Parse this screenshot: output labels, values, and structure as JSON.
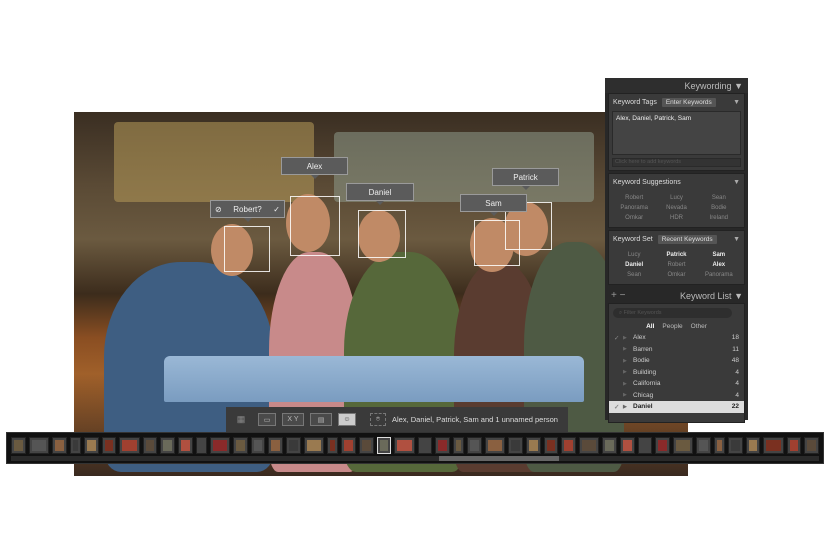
{
  "faces": [
    {
      "label": "Robert?",
      "unconfirmed": true
    },
    {
      "label": "Alex"
    },
    {
      "label": "Daniel"
    },
    {
      "label": "Sam"
    },
    {
      "label": "Patrick"
    }
  ],
  "panel": {
    "title": "Keywording",
    "keyword_tags": {
      "label": "Keyword Tags",
      "mode": "Enter Keywords",
      "value": "Alex, Daniel, Patrick, Sam",
      "placeholder": "Click here to add keywords"
    },
    "suggestions": {
      "label": "Keyword Suggestions",
      "items": [
        "Robert",
        "Lucy",
        "Sean",
        "Panorama",
        "Nevada",
        "Bodie",
        "Omkar",
        "HDR",
        "Ireland"
      ]
    },
    "keyword_set": {
      "label": "Keyword Set",
      "selected": "Recent Keywords",
      "items": [
        {
          "t": "Lucy",
          "on": false
        },
        {
          "t": "Patrick",
          "on": true
        },
        {
          "t": "Sam",
          "on": true
        },
        {
          "t": "Daniel",
          "on": true
        },
        {
          "t": "Robert",
          "on": false
        },
        {
          "t": "Alex",
          "on": true
        },
        {
          "t": "Sean",
          "on": false
        },
        {
          "t": "Omkar",
          "on": false
        },
        {
          "t": "Panorama",
          "on": false
        }
      ]
    },
    "keyword_list": {
      "label": "Keyword List",
      "filter_placeholder": "Filter Keywords",
      "filters": [
        "All",
        "People",
        "Other"
      ],
      "items": [
        {
          "name": "Alex",
          "count": "18",
          "checked": true
        },
        {
          "name": "Barren",
          "count": "11"
        },
        {
          "name": "Bodie",
          "count": "48"
        },
        {
          "name": "Building",
          "count": "4"
        },
        {
          "name": "California",
          "count": "4"
        },
        {
          "name": "Chicag",
          "count": "4"
        },
        {
          "name": "Daniel",
          "count": "22",
          "checked": true,
          "selected": true
        }
      ]
    }
  },
  "toolbar": {
    "xy_label": "X Y",
    "status": "Alex, Daniel, Patrick, Sam and 1 unnamed person"
  },
  "colors": {
    "panel_bg": "#282828",
    "toolbar_bg": "#3a3a3a",
    "filmstrip_bg": "#111111"
  }
}
